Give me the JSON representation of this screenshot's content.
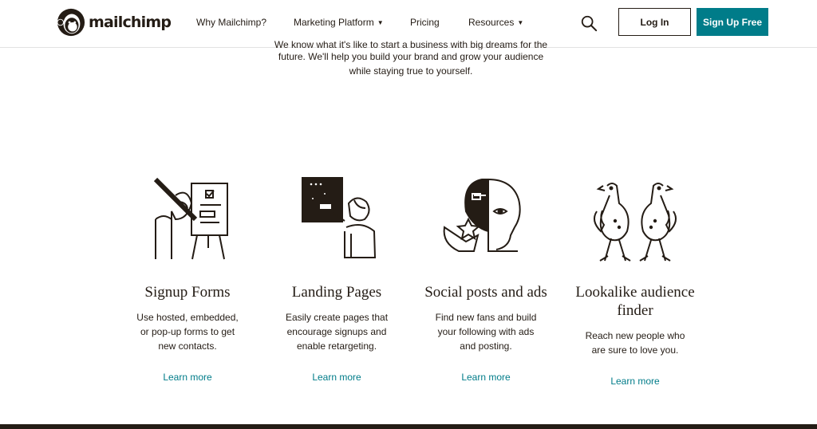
{
  "header": {
    "logo_text": "mailchimp",
    "nav": [
      {
        "label": "Why Mailchimp?",
        "has_menu": false
      },
      {
        "label": "Marketing Platform",
        "has_menu": true
      },
      {
        "label": "Pricing",
        "has_menu": false
      },
      {
        "label": "Resources",
        "has_menu": true
      }
    ],
    "login_label": "Log In",
    "signup_label": "Sign Up Free"
  },
  "intro": {
    "line1": "We know what it's like to start a business with big dreams for the",
    "line2": "future. We'll help you build your brand and grow your audience",
    "line3": "while staying true to yourself."
  },
  "features": [
    {
      "title": "Signup Forms",
      "description": "Use hosted, embedded, or pop-up forms to get new contacts.",
      "link": "Learn more",
      "icon": "signup-form-illustration"
    },
    {
      "title": "Landing Pages",
      "description": "Easily create pages that encourage signups and enable retargeting.",
      "link": "Learn more",
      "icon": "landing-page-illustration"
    },
    {
      "title": "Social posts and ads",
      "description": "Find new fans and build your following with ads and posting.",
      "link": "Learn more",
      "icon": "social-posts-illustration"
    },
    {
      "title": "Lookalike audience finder",
      "description": "Reach new people who are sure to love you.",
      "link": "Learn more",
      "icon": "lookalike-birds-illustration"
    }
  ],
  "colors": {
    "brand_teal": "#007c89",
    "ink": "#241c15",
    "divider": "#e2e2e2"
  }
}
